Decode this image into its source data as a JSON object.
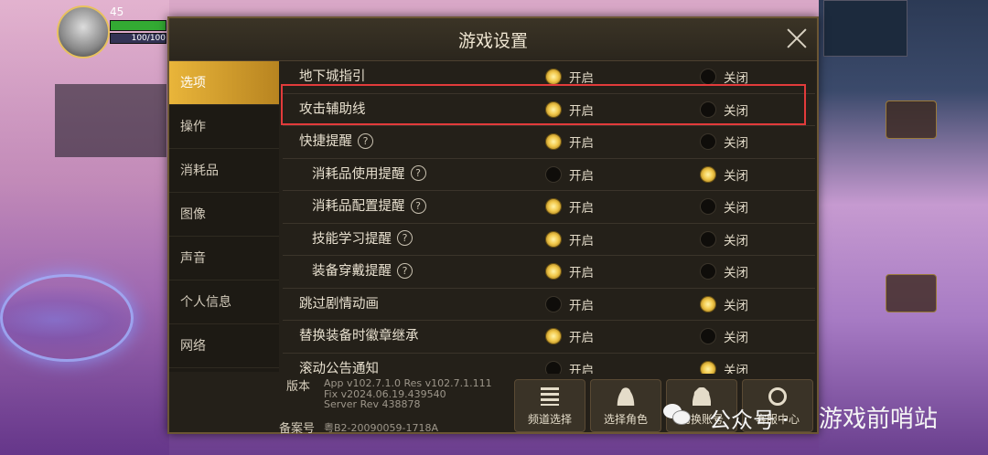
{
  "dialog": {
    "title": "游戏设置"
  },
  "hud": {
    "level": "45",
    "mp": "100/100"
  },
  "sidebar": {
    "tabs": [
      "选项",
      "操作",
      "消耗品",
      "图像",
      "声音",
      "个人信息",
      "网络"
    ]
  },
  "settings": [
    {
      "label": "地下城指引",
      "on": "开启",
      "off": "关闭",
      "value": "on",
      "help": false,
      "sub": false
    },
    {
      "label": "攻击辅助线",
      "on": "开启",
      "off": "关闭",
      "value": "on",
      "help": false,
      "sub": false
    },
    {
      "label": "快捷提醒",
      "on": "开启",
      "off": "关闭",
      "value": "on",
      "help": true,
      "sub": false
    },
    {
      "label": "消耗品使用提醒",
      "on": "开启",
      "off": "关闭",
      "value": "off",
      "help": true,
      "sub": true
    },
    {
      "label": "消耗品配置提醒",
      "on": "开启",
      "off": "关闭",
      "value": "on",
      "help": true,
      "sub": true
    },
    {
      "label": "技能学习提醒",
      "on": "开启",
      "off": "关闭",
      "value": "on",
      "help": true,
      "sub": true
    },
    {
      "label": "装备穿戴提醒",
      "on": "开启",
      "off": "关闭",
      "value": "on",
      "help": true,
      "sub": true
    },
    {
      "label": "跳过剧情动画",
      "on": "开启",
      "off": "关闭",
      "value": "off",
      "help": false,
      "sub": false
    },
    {
      "label": "替换装备时徽章继承",
      "on": "开启",
      "off": "关闭",
      "value": "on",
      "help": false,
      "sub": false
    },
    {
      "label": "滚动公告通知",
      "on": "开启",
      "off": "关闭",
      "value": "off",
      "help": false,
      "sub": false
    }
  ],
  "footer": {
    "version_label": "版本",
    "version_line1": "App v102.7.1.0 Res v102.7.1.111",
    "version_line2": "Fix v2024.06.19.439540",
    "version_line3": "Server Rev 438878",
    "beian_label": "备案号",
    "beian_value": "粤B2-20090059-1718A",
    "buttons": [
      {
        "label": "频道选择",
        "icon": "menu-icon"
      },
      {
        "label": "选择角色",
        "icon": "person-icon"
      },
      {
        "label": "切换账号",
        "icon": "group-icon"
      },
      {
        "label": "客服中心",
        "icon": "headset-icon"
      }
    ]
  },
  "watermark": {
    "part1": "公众号 ·",
    "part2": "游戏前哨站"
  },
  "colors": {
    "accent": "#e9b53a",
    "highlight_box": "#e23b3b",
    "panel": "#242019"
  }
}
